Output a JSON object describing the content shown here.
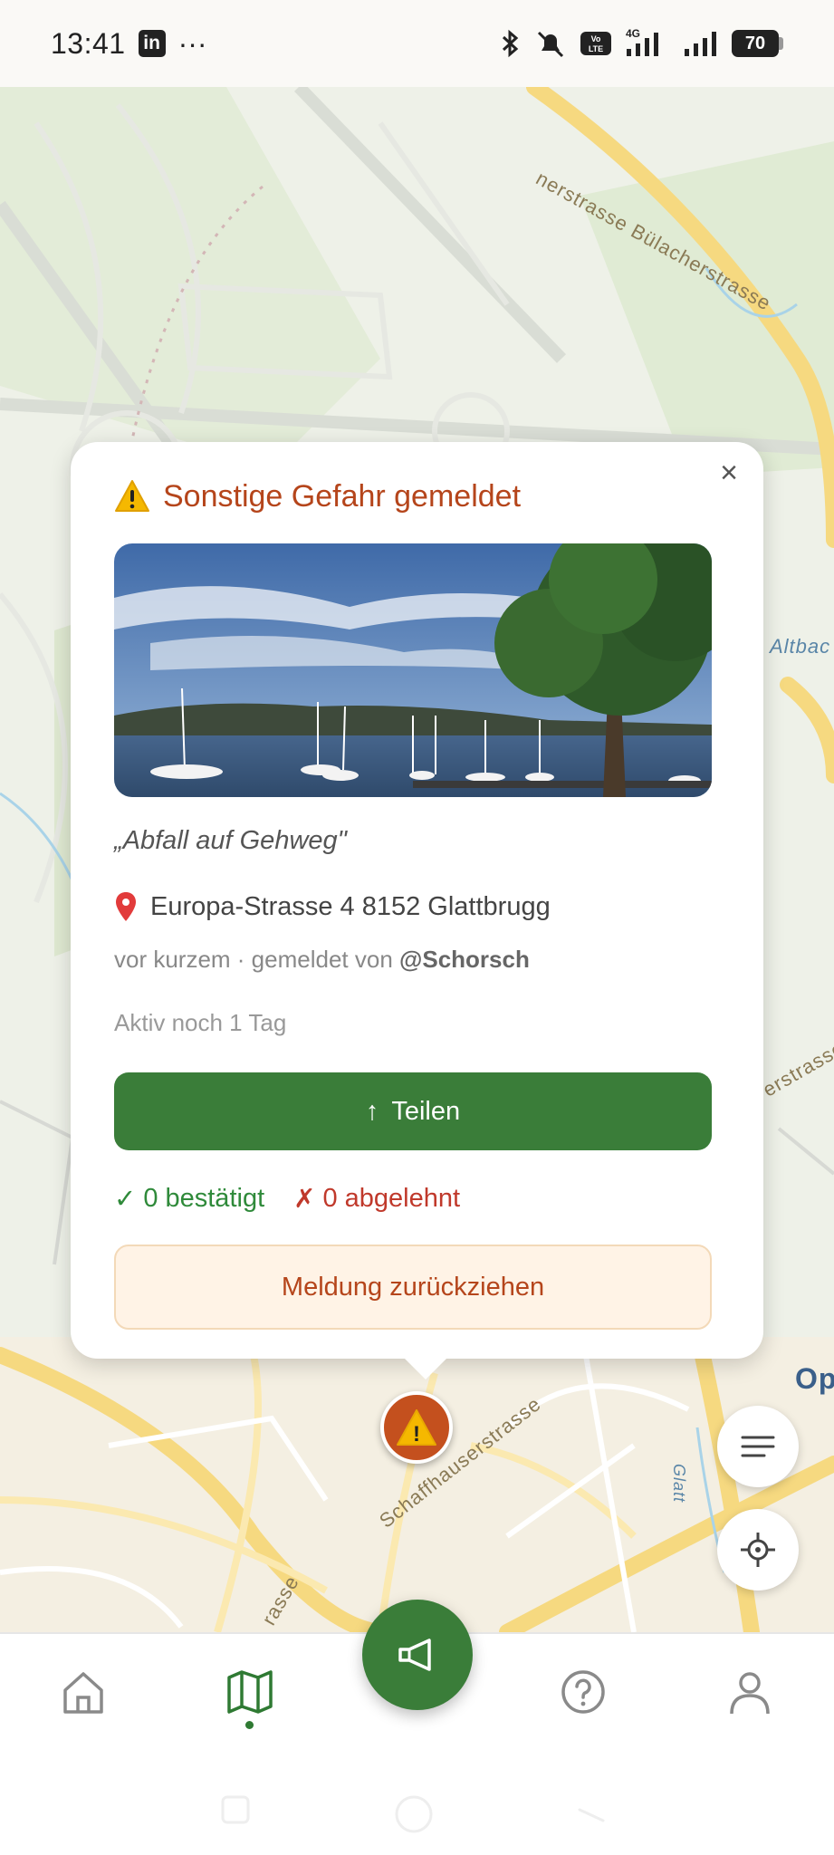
{
  "status_bar": {
    "time": "13:41",
    "app_icon": "linkedin-icon",
    "more": "···",
    "network": "4G",
    "battery": "70"
  },
  "map": {
    "labels": {
      "street_top": "nerstrasse Bülacherstrasse",
      "altbach": "Altbac",
      "street_right": "erstrasse",
      "op": "Op",
      "schaff": "Schaffhauserstrasse",
      "asse": "rasse",
      "glatt": "Glatt"
    }
  },
  "popup": {
    "close": "×",
    "title": "Sonstige Gefahr gemeldet",
    "title_icon": "warning-icon",
    "quote": "„Abfall auf Gehweg\"",
    "address": "Europa-Strasse 4 8152 Glattbrugg",
    "meta_prefix": "vor kurzem · gemeldet von ",
    "meta_user": "@Schorsch",
    "active": "Aktiv noch 1 Tag",
    "share_arrow": "↑",
    "share_label": "Teilen",
    "confirmed_icon": "✓",
    "confirmed_label": "0 bestätigt",
    "rejected_icon": "✗",
    "rejected_label": "0 abgelehnt",
    "withdraw_label": "Meldung zurückziehen"
  },
  "marker": {
    "icon": "warning-icon",
    "symbol": "!"
  },
  "nav": {
    "items": [
      "home-icon",
      "map-icon",
      "megaphone-icon",
      "help-icon",
      "profile-icon"
    ],
    "active": "map-icon"
  },
  "colors": {
    "brand_green": "#3a7d39",
    "hazard_orange": "#c4501e",
    "title_orange": "#b5451b",
    "confirmed_green": "#2f8a3a",
    "rejected_red": "#c0392b"
  }
}
